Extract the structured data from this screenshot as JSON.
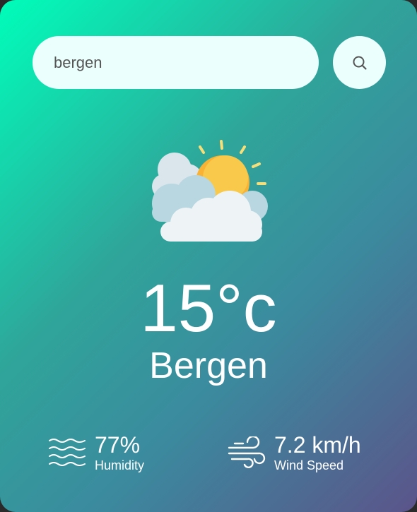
{
  "search": {
    "value": "bergen",
    "button_icon": "search-icon"
  },
  "weather": {
    "icon": "partly-cloudy-sun-icon",
    "temperature": "15°c",
    "city": "Bergen"
  },
  "details": {
    "humidity": {
      "icon": "humidity-waves-icon",
      "value": "77%",
      "label": "Humidity"
    },
    "wind": {
      "icon": "wind-icon",
      "value": "7.2 km/h",
      "label": "Wind Speed"
    }
  },
  "colors": {
    "gradient_start": "#00feba",
    "gradient_end": "#5b548a",
    "input_bg": "#ebfffc",
    "text": "#ffffff"
  }
}
